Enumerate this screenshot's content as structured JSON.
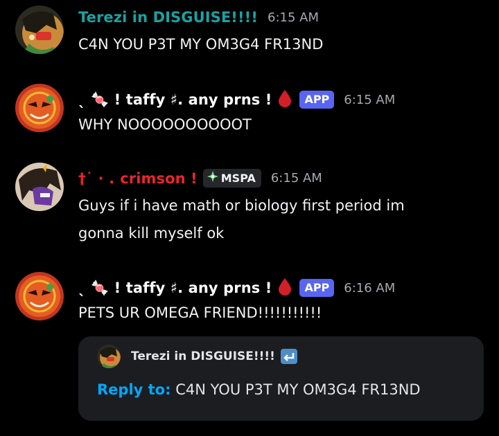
{
  "colors": {
    "background": "#000000",
    "terezi_name": "#17a3a3",
    "taffy_name": "#ffffff",
    "crimson_name": "#e8262b",
    "app_badge": "#5865f2",
    "reply_prefix": "#00a8fc"
  },
  "messages": [
    {
      "author": "Terezi in DISGUISE!!!!",
      "time": "6:15 AM",
      "lines": [
        "C4N YOU P3T MY OM3G4 FR13ND"
      ]
    },
    {
      "author": "ˎ 🍬  !  taffy ♯. any prns  !",
      "badge_icon": "blood-drop-icon",
      "badge": "APP",
      "time": "6:15 AM",
      "lines": [
        "WHY NOOOOOOOOOOT"
      ]
    },
    {
      "author_prefix": "†˙ ·  .",
      "author": "crimson !",
      "badge": "MSPA",
      "time": "6:15 AM",
      "lines": [
        "Guys if i have math or biology first period im",
        "gonna kill myself ok"
      ]
    },
    {
      "author": "ˎ 🍬  !  taffy ♯. any prns  !",
      "badge_icon": "blood-drop-icon",
      "badge": "APP",
      "time": "6:16 AM",
      "lines": [
        "PETS UR OMEGA FRIEND!!!!!!!!!!!"
      ]
    }
  ],
  "reply_card": {
    "author": "Terezi in DISGUISE!!!!",
    "prefix": "Reply to:",
    "text": "C4N YOU P3T MY OM3G4 FR13ND"
  }
}
